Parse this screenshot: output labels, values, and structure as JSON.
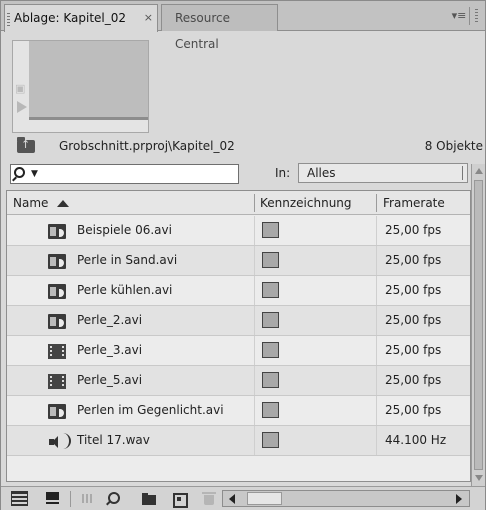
{
  "tabs": {
    "active_label": "Ablage: Kapitel_02",
    "active_close": "×",
    "inactive_label": "Resource Central",
    "menu_glyph": "▾≡"
  },
  "path": {
    "text": "Grobschnitt.prproj\\Kapitel_02",
    "count": "8 Objekte"
  },
  "search": {
    "value": "",
    "dropdown_glyph": "▼",
    "in_label": "In:",
    "in_value": "Alles"
  },
  "table": {
    "headers": {
      "name": "Name",
      "label": "Kennzeichnung",
      "framerate": "Framerate"
    },
    "rows": [
      {
        "name": "Beispiele 06.avi",
        "icon": "av-clip-icon",
        "framerate": "25,00 fps"
      },
      {
        "name": "Perle in Sand.avi",
        "icon": "av-clip-icon",
        "framerate": "25,00 fps"
      },
      {
        "name": "Perle kühlen.avi",
        "icon": "av-clip-icon",
        "framerate": "25,00 fps"
      },
      {
        "name": "Perle_2.avi",
        "icon": "av-clip-icon",
        "framerate": "25,00 fps"
      },
      {
        "name": "Perle_3.avi",
        "icon": "video-clip-icon",
        "framerate": "25,00 fps"
      },
      {
        "name": "Perle_5.avi",
        "icon": "video-clip-icon",
        "framerate": "25,00 fps"
      },
      {
        "name": "Perlen im Gegenlicht.avi",
        "icon": "av-clip-icon",
        "framerate": "25,00 fps"
      },
      {
        "name": "Titel 17.wav",
        "icon": "audio-clip-icon",
        "framerate": "44.100 Hz"
      }
    ]
  },
  "colors": {
    "panel_bg": "#d9d9d9",
    "label_swatch": "#a8a8a8"
  }
}
